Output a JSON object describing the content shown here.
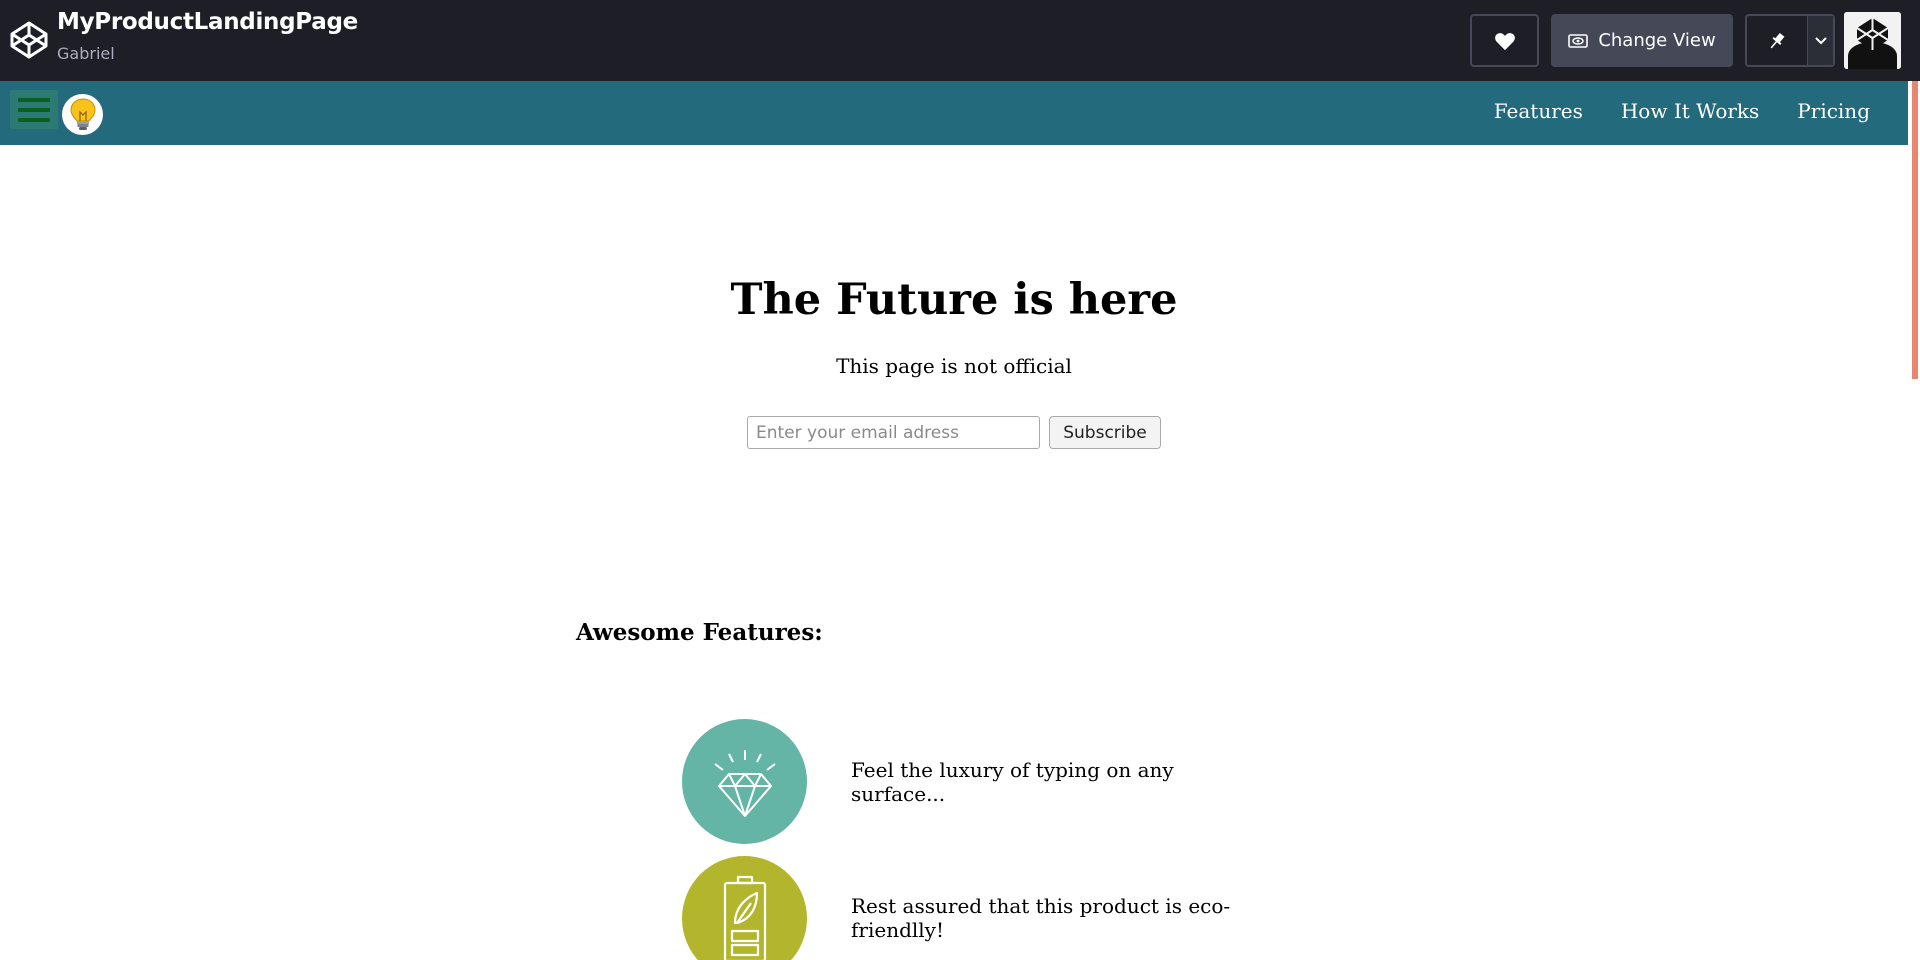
{
  "header": {
    "pen_title": "MyProductLandingPage",
    "author": "Gabriel",
    "change_view_label": "Change View",
    "icons": [
      "codepen-icon",
      "heart-icon",
      "eye-icon",
      "pin-icon",
      "chevron-down-icon",
      "avatar"
    ]
  },
  "navbar": {
    "links": [
      "Features",
      "How It Works",
      "Pricing"
    ],
    "colors": {
      "background": "#246a7d",
      "hamburger": "#0b5f1e"
    }
  },
  "hero": {
    "title": "The Future is here",
    "subtitle": "This page is not official",
    "email_placeholder": "Enter your email adress",
    "email_value": "",
    "subscribe_label": "Subscribe"
  },
  "features": {
    "heading": "Awesome Features:",
    "items": [
      {
        "icon": "diamond-icon",
        "color": "#64b5a6",
        "text": "Feel the luxury of typing on any surface..."
      },
      {
        "icon": "eco-battery-icon",
        "color": "#b3b62c",
        "text": "Rest assured that this product is eco-friendlly!"
      }
    ]
  }
}
